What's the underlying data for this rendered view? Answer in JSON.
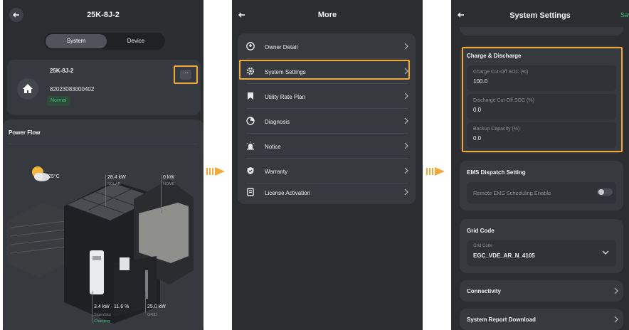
{
  "screen1": {
    "title": "25K-8J-2",
    "tabs": [
      "System",
      "Device"
    ],
    "system_name": "25K-8J-2",
    "serial": "82023083000402",
    "status": "Normal",
    "more_label": "···",
    "power_flow_title": "Power Flow",
    "temperature": "25°C",
    "solar_value": "28.4 kW",
    "solar_label": "SOLAR",
    "home_value": "0 kW",
    "home_label": "HOME",
    "battery_value": "3.4 kW · 11.6 %",
    "battery_label": "SigenStor",
    "battery_status": "Charging",
    "grid_value": "25.0 kW",
    "grid_label": "GRID"
  },
  "screen2": {
    "title": "More",
    "items": [
      {
        "label": "Owner Detail",
        "icon": "user-icon"
      },
      {
        "label": "System Settings",
        "icon": "gear-icon"
      },
      {
        "label": "Utility Rate Plan",
        "icon": "bookmark-icon"
      },
      {
        "label": "Diagnosis",
        "icon": "pie-icon"
      },
      {
        "label": "Notice",
        "icon": "alarm-icon"
      },
      {
        "label": "Warranty",
        "icon": "shield-icon"
      },
      {
        "label": "License Activation",
        "icon": "license-icon"
      }
    ]
  },
  "screen3": {
    "title": "System Settings",
    "save_label": "Sav",
    "charge_title": "Charge & Discharge",
    "fields": [
      {
        "label": "Charge Cut-Off SOC (%)",
        "value": "100.0"
      },
      {
        "label": "Discharge Cut-Off SOC (%)",
        "value": "0.0"
      },
      {
        "label": "Backup Capacity (%)",
        "value": "0.0"
      }
    ],
    "ems_title": "EMS Dispatch Setting",
    "ems_toggle_label": "Remote EMS Scheduling Enable",
    "ems_enabled": false,
    "grid_title": "Grid Code",
    "grid_label": "Grid Code",
    "grid_value": "EGC_VDE_AR_N_4105",
    "connectivity": "Connectivity",
    "report": "System Report Download"
  },
  "colors": {
    "background": "#2b2d31",
    "card": "#36393e",
    "accent": "#f0a93a",
    "status_green": "#3ec27a"
  }
}
